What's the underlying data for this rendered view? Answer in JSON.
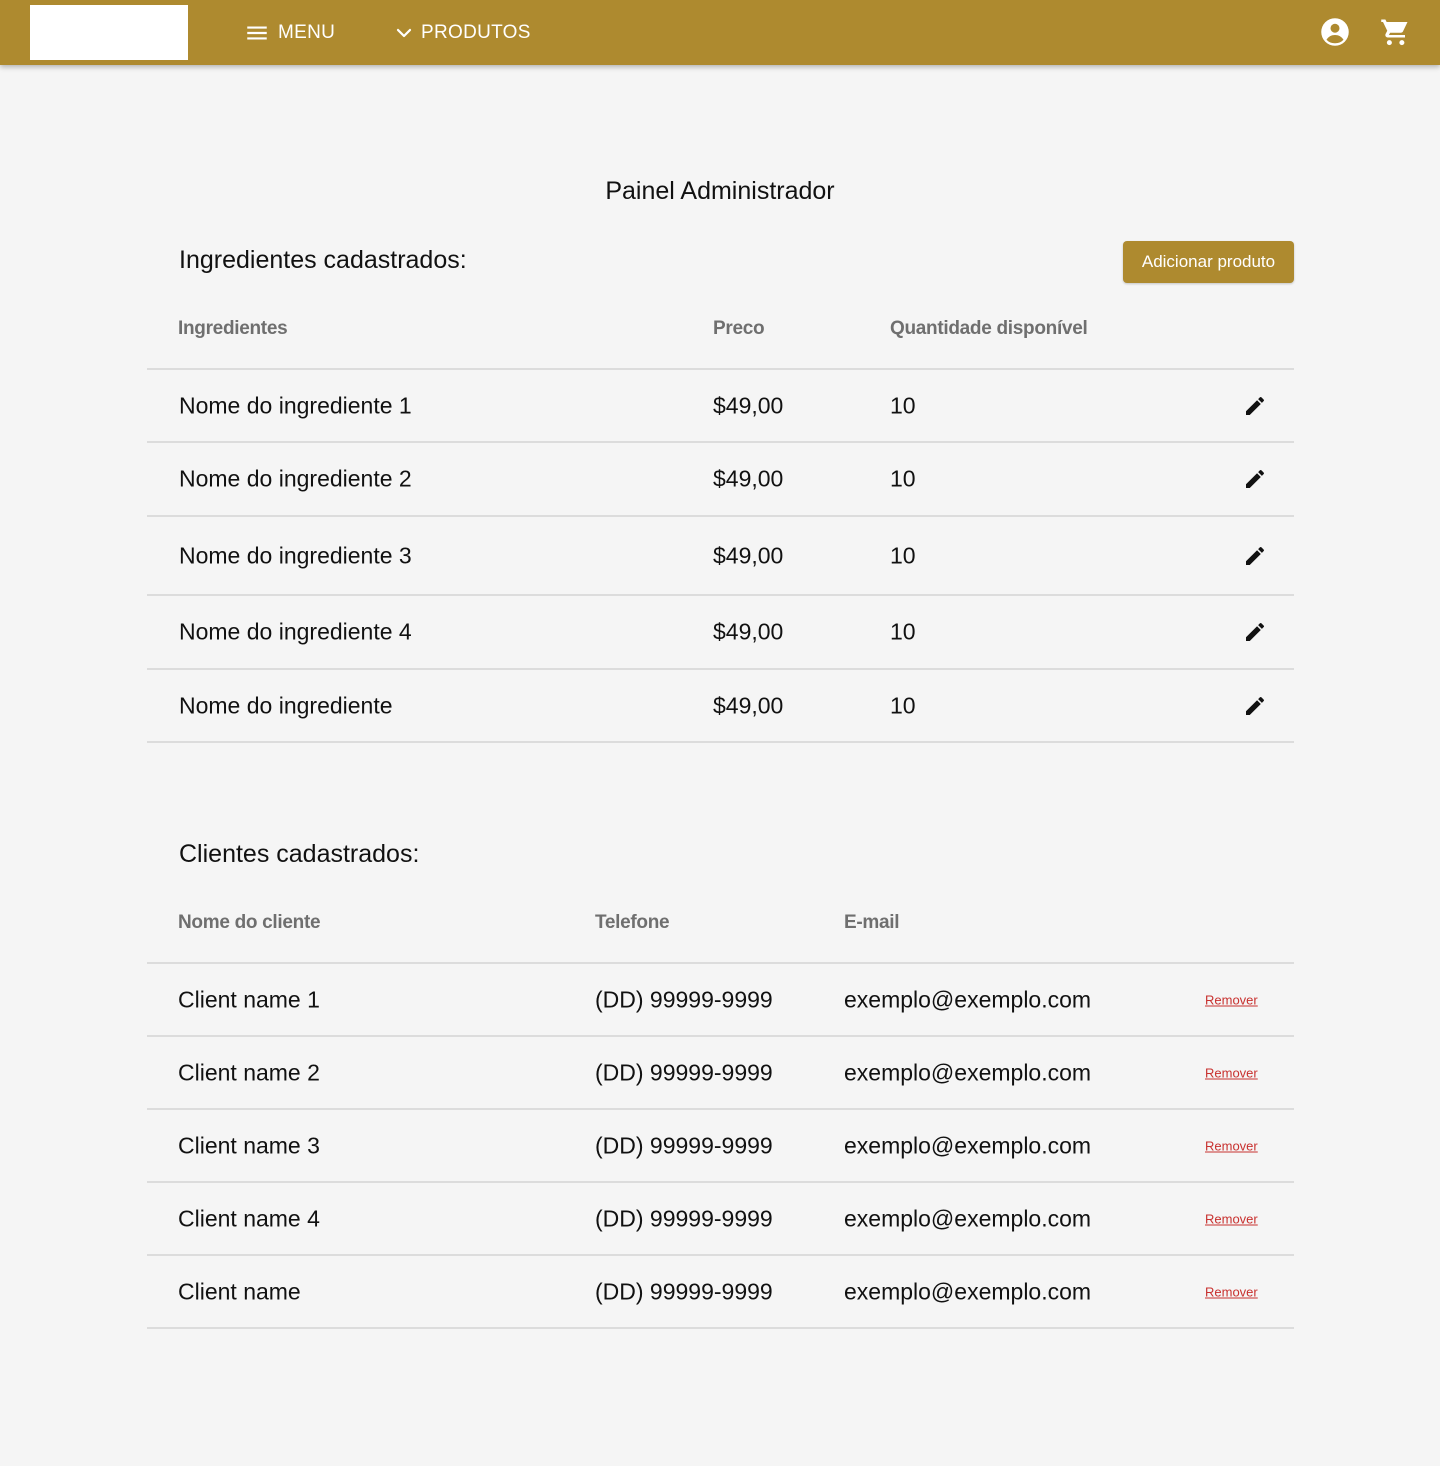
{
  "header": {
    "menu_label": "MENU",
    "products_label": "PRODUTOS",
    "icons": {
      "menu": "menu-icon",
      "products": "chevron-down-icon",
      "account": "account-circle-icon",
      "cart": "shopping-cart-icon"
    },
    "bar_color": "#ae8a2f"
  },
  "page": {
    "title": "Painel Administrador"
  },
  "ingredients": {
    "section_title": "Ingredientes cadastrados:",
    "add_button_label": "Adicionar produto",
    "columns": [
      "Ingredientes",
      "Preco",
      "Quantidade disponível"
    ],
    "rows": [
      {
        "name": "Nome do ingrediente 1",
        "price": "$49,00",
        "qty": "10"
      },
      {
        "name": "Nome do ingrediente 2",
        "price": "$49,00",
        "qty": "10"
      },
      {
        "name": "Nome do ingrediente 3",
        "price": "$49,00",
        "qty": "10"
      },
      {
        "name": "Nome do ingrediente 4",
        "price": "$49,00",
        "qty": "10"
      },
      {
        "name": "Nome do ingrediente",
        "price": "$49,00",
        "qty": "10"
      }
    ],
    "row_action_icon": "pencil-edit-icon"
  },
  "clients": {
    "section_title": "Clientes cadastrados:",
    "columns": [
      "Nome do cliente",
      "Telefone",
      "E-mail"
    ],
    "rows": [
      {
        "name": "Client name 1",
        "phone": "(DD) 99999-9999",
        "email": "exemplo@exemplo.com",
        "action": "Remover"
      },
      {
        "name": "Client name 2",
        "phone": "(DD) 99999-9999",
        "email": "exemplo@exemplo.com",
        "action": "Remover"
      },
      {
        "name": "Client name 3",
        "phone": "(DD) 99999-9999",
        "email": "exemplo@exemplo.com",
        "action": "Remover"
      },
      {
        "name": "Client name 4",
        "phone": "(DD) 99999-9999",
        "email": "exemplo@exemplo.com",
        "action": "Remover"
      },
      {
        "name": "Client name",
        "phone": "(DD) 99999-9999",
        "email": "exemplo@exemplo.com",
        "action": "Remover"
      }
    ],
    "remove_color": "#c8312f"
  }
}
